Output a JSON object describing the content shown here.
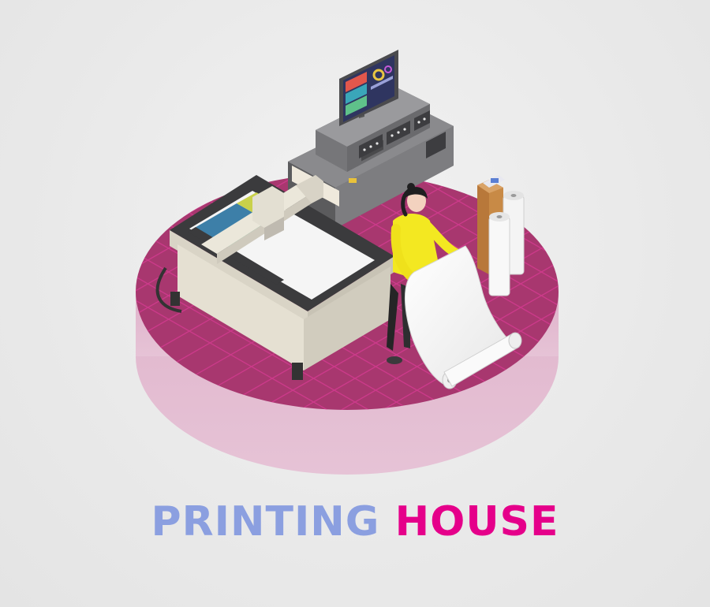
{
  "title": {
    "word1": "PRINTING",
    "word2": "HOUSE"
  },
  "colors": {
    "background": "#eaeaea",
    "platform_top": "#a8376f",
    "platform_grid": "#d23e91",
    "platform_side": "#dba9c4",
    "title_word1": "#8b9fe0",
    "title_word2": "#e5008a",
    "worker_shirt": "#f3e821"
  },
  "illustration": {
    "elements": [
      "platform-icon",
      "cutting-table-icon",
      "control-console-icon",
      "monitor-icon",
      "worker-icon",
      "paper-roll-icon",
      "roll-stack-icon",
      "box-icon"
    ]
  }
}
